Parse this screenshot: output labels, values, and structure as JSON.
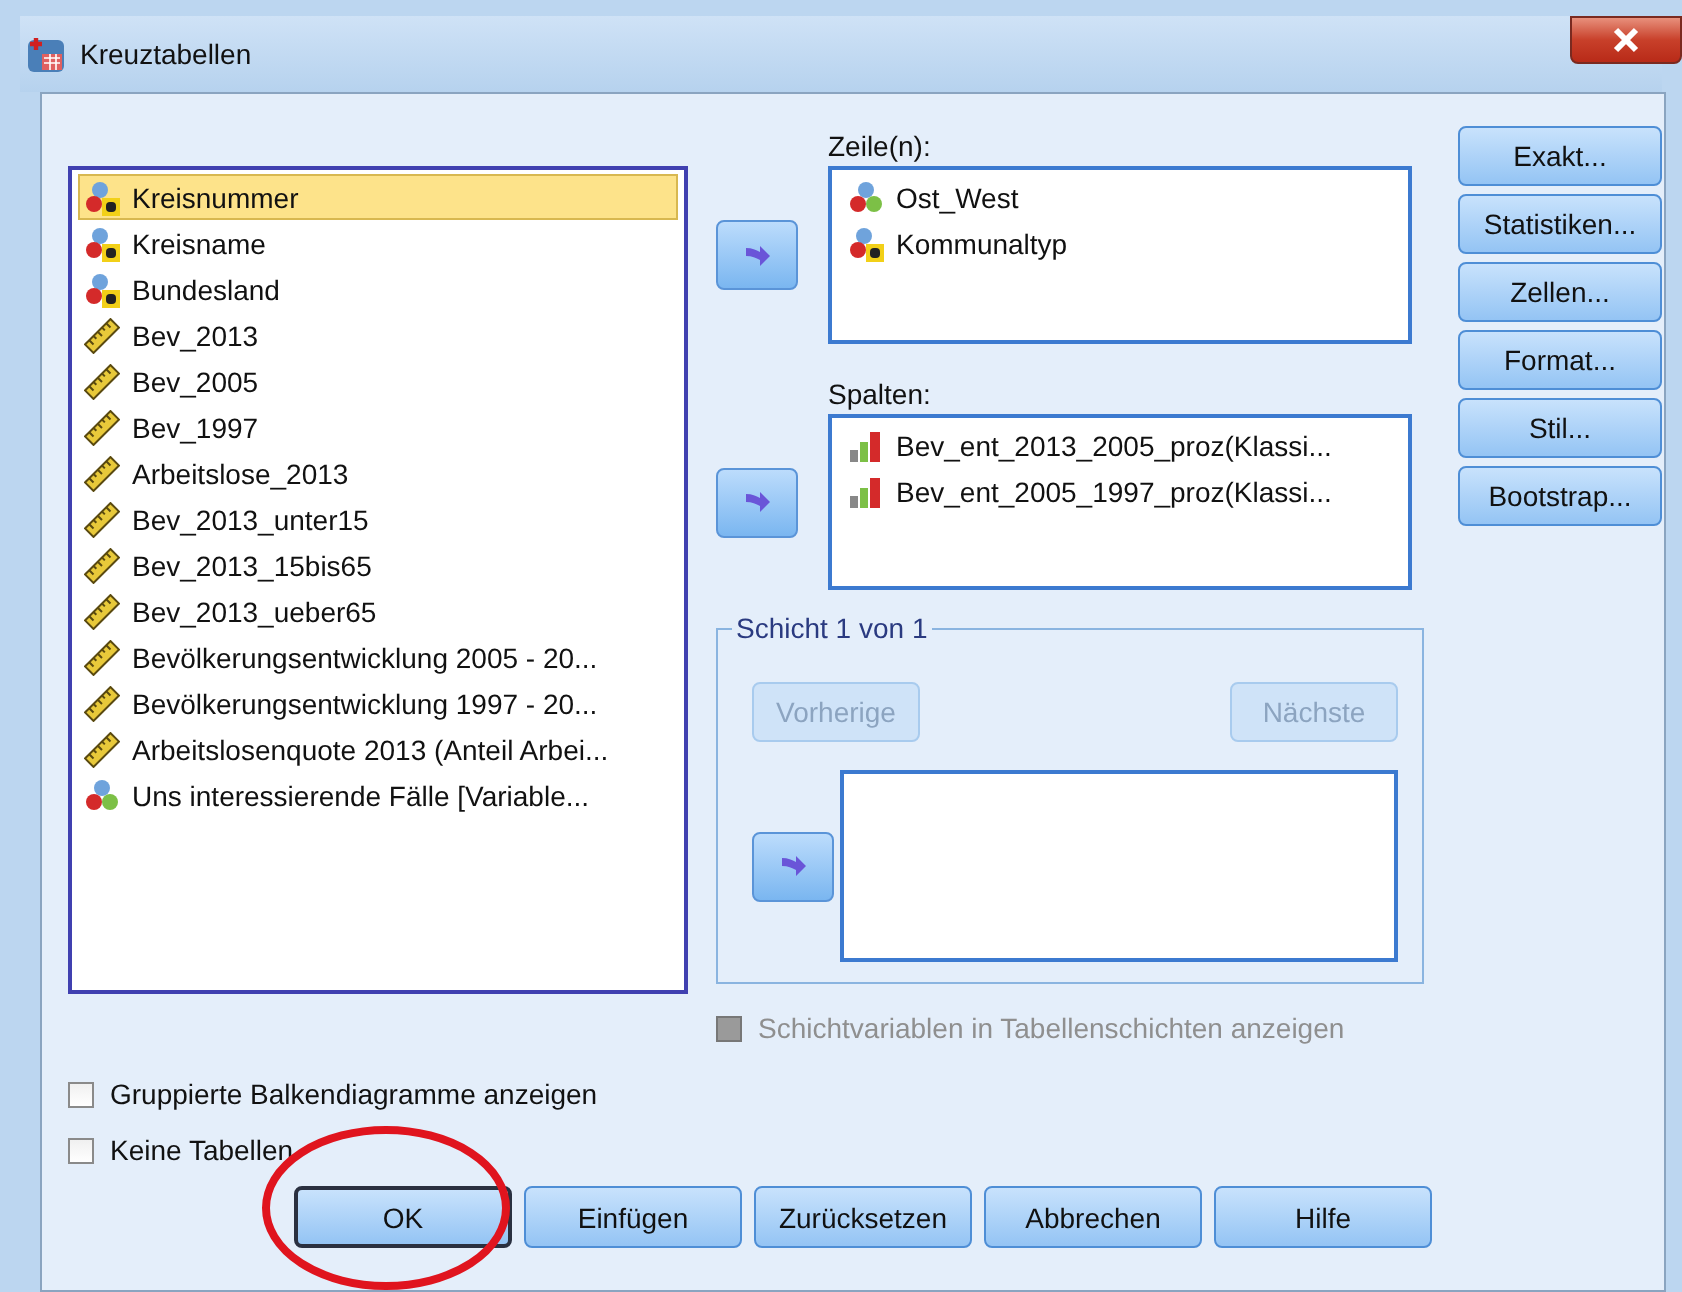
{
  "window": {
    "title": "Kreuztabellen"
  },
  "variables": [
    {
      "name": "Kreisnummer",
      "kind": "nominal_text",
      "selected": true
    },
    {
      "name": "Kreisname",
      "kind": "nominal_text",
      "selected": false
    },
    {
      "name": "Bundesland",
      "kind": "nominal_text",
      "selected": false
    },
    {
      "name": "Bev_2013",
      "kind": "scale",
      "selected": false
    },
    {
      "name": "Bev_2005",
      "kind": "scale",
      "selected": false
    },
    {
      "name": "Bev_1997",
      "kind": "scale",
      "selected": false
    },
    {
      "name": "Arbeitslose_2013",
      "kind": "scale",
      "selected": false
    },
    {
      "name": "Bev_2013_unter15",
      "kind": "scale",
      "selected": false
    },
    {
      "name": "Bev_2013_15bis65",
      "kind": "scale",
      "selected": false
    },
    {
      "name": "Bev_2013_ueber65",
      "kind": "scale",
      "selected": false
    },
    {
      "name": "Bevölkerungsentwicklung 2005 - 20...",
      "kind": "scale",
      "selected": false
    },
    {
      "name": "Bevölkerungsentwicklung 1997 - 20...",
      "kind": "scale",
      "selected": false
    },
    {
      "name": "Arbeitslosenquote 2013 (Anteil Arbei...",
      "kind": "scale",
      "selected": false
    },
    {
      "name": "Uns interessierende Fälle [Variable...",
      "kind": "nominal",
      "selected": false
    }
  ],
  "rows_box": {
    "label": "Zeile(n):",
    "items": [
      {
        "name": "Ost_West",
        "kind": "nominal"
      },
      {
        "name": "Kommunaltyp",
        "kind": "nominal_text"
      }
    ]
  },
  "columns_box": {
    "label": "Spalten:",
    "items": [
      {
        "name": "Bev_ent_2013_2005_proz(Klassi...",
        "kind": "ordinal"
      },
      {
        "name": "Bev_ent_2005_1997_proz(Klassi...",
        "kind": "ordinal"
      }
    ]
  },
  "layer_group": {
    "title": "Schicht 1 von 1",
    "buttons": [
      {
        "label": "Vorherige",
        "disabled": true
      },
      {
        "label": "Nächste",
        "disabled": true
      }
    ]
  },
  "layer_option": {
    "label": "Schichtvariablen in Tabellenschichten anzeigen",
    "checked": false,
    "disabled": true
  },
  "side_buttons": [
    "Exakt...",
    "Statistiken...",
    "Zellen...",
    "Format...",
    "Stil...",
    "Bootstrap..."
  ],
  "options": [
    {
      "label": "Gruppierte Balkendiagramme anzeigen",
      "checked": false
    },
    {
      "label": "Keine Tabellen",
      "checked": false
    }
  ],
  "buttons": [
    {
      "label": "OK",
      "default": true,
      "circled": true
    },
    {
      "label": "Einfügen",
      "default": false,
      "circled": false
    },
    {
      "label": "Zurücksetzen",
      "default": false,
      "circled": false
    },
    {
      "label": "Abbrechen",
      "default": false,
      "circled": false
    },
    {
      "label": "Hilfe",
      "default": false,
      "circled": false
    }
  ]
}
